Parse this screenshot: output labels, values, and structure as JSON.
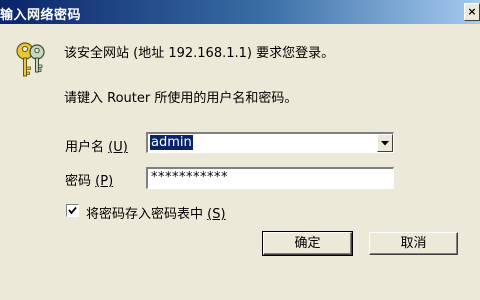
{
  "window": {
    "title": "输入网络密码",
    "close_glyph": "×"
  },
  "message": {
    "line1": "该安全网站 (地址 192.168.1.1) 要求您登录。",
    "line2": "请键入 Router 所使用的用户名和密码。"
  },
  "username": {
    "label": "用户名",
    "mnemonic": "(U)",
    "value": "admin"
  },
  "password": {
    "label": "密码",
    "mnemonic": "(P)",
    "value": "***********"
  },
  "remember": {
    "checked": true,
    "label": "将密码存入密码表中",
    "mnemonic": "(S)"
  },
  "buttons": {
    "ok": "确定",
    "cancel": "取消"
  },
  "icons": {
    "keys": "keys-icon",
    "close": "close-icon",
    "dropdown": "chevron-down-icon",
    "checkmark": "checkmark-icon"
  },
  "colors": {
    "titlebar_start": "#0a246a",
    "titlebar_end": "#a6caf0",
    "dialog_bg": "#ece9d8",
    "selection": "#0a246a"
  }
}
